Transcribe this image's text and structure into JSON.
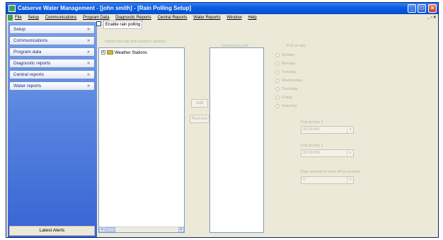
{
  "window": {
    "title": "Catserve Water Management - [john smith] - [Rain Polling Setup]",
    "controls": {
      "minimize": "_",
      "maximize": "□",
      "close": "×"
    }
  },
  "menubar": {
    "items": [
      "File",
      "Setup",
      "Communications",
      "Program Data",
      "Diagnostic Reports",
      "Central Reports",
      "Water Reports",
      "Window",
      "Help"
    ],
    "mdi_controls": "_ ▫ ×"
  },
  "sidebar": {
    "items": [
      {
        "label": "Setup",
        "chevron": "»"
      },
      {
        "label": "Communications",
        "chevron": "»"
      },
      {
        "label": "Program data",
        "chevron": "»"
      },
      {
        "label": "Diagnostic reports",
        "chevron": "»"
      },
      {
        "label": "Central reports",
        "chevron": "»"
      },
      {
        "label": "Water reports",
        "chevron": "»"
      }
    ],
    "latest_alerts": "Latest Alerts"
  },
  "main": {
    "enable_checkbox": {
      "label": "Enable rain polling",
      "checked": false
    },
    "tree_caption": "Select the rain poll weather stations",
    "tree_root": {
      "label": "Weather Stations",
      "expander": "+"
    },
    "selected_caption": "Selected to poll",
    "add_button": "Add",
    "remove_button": "Remove",
    "poll_day_caption": "Poll on day",
    "days": [
      "Sunday",
      "Monday",
      "Tuesday",
      "Wednesday",
      "Thursday",
      "Friday",
      "Saturday"
    ],
    "time1": {
      "caption": "Poll at time 1",
      "value": "06:00 AM"
    },
    "time2": {
      "caption": "Poll at time 2",
      "value": "06:00 PM"
    },
    "threshold": {
      "caption": "Rain amount to shut off (in inches)",
      "value": "0"
    },
    "scroll": {
      "left": "◂",
      "right": "▸"
    }
  }
}
